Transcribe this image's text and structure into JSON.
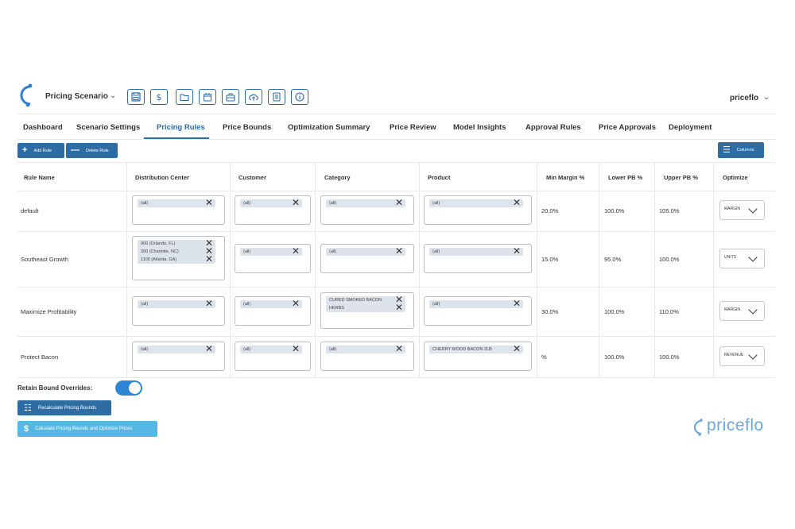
{
  "header": {
    "scenario_label": "Pricing Scenario",
    "user": "priceflo",
    "toolbar_icons": [
      "save-icon",
      "dollar-icon",
      "folder-icon",
      "calendar-icon",
      "briefcase-icon",
      "cloud-upload-icon",
      "document-icon",
      "info-icon"
    ]
  },
  "tabs": [
    "Dashboard",
    "Scenario Settings",
    "Pricing Rules",
    "Price Bounds",
    "Optimization Summary",
    "Price Review",
    "Model Insights",
    "Approval Rules",
    "Price Approvals",
    "Deployment"
  ],
  "active_tab": "Pricing Rules",
  "actions": {
    "add_rule": "Add Rule",
    "delete_rule": "Delete Rule",
    "columns": "Columns"
  },
  "table": {
    "headers": [
      "Rule Name",
      "Distribution Center",
      "Customer",
      "Category",
      "Product",
      "Min Margin %",
      "Lower PB %",
      "Upper PB %",
      "Optimize"
    ],
    "rows": [
      {
        "name": "default",
        "dc": [
          "(all)"
        ],
        "customer": [
          "(all)"
        ],
        "category": [
          "(all)"
        ],
        "product": [
          "(all)"
        ],
        "min_margin": "20.0%",
        "lower_pb": "100.0%",
        "upper_pb": "105.0%",
        "optimize": "MARGIN"
      },
      {
        "name": "Southeast Growth",
        "dc": [
          "900 (Orlando, FL)",
          "200 (Charlotte, NC)",
          "1100 (Atlanta, GA)"
        ],
        "customer": [
          "(all)"
        ],
        "category": [
          "(all)"
        ],
        "product": [
          "(all)"
        ],
        "min_margin": "15.0%",
        "lower_pb": "95.0%",
        "upper_pb": "100.0%",
        "optimize": "UNITS"
      },
      {
        "name": "Maximize Profitability",
        "dc": [
          "(all)"
        ],
        "customer": [
          "(all)"
        ],
        "category": [
          "CURED SMOKED BACON",
          "HERBS"
        ],
        "product": [
          "(all)"
        ],
        "min_margin": "30.0%",
        "lower_pb": "100.0%",
        "upper_pb": "110.0%",
        "optimize": "MARGIN"
      },
      {
        "name": "Protect Bacon",
        "dc": [
          "(all)"
        ],
        "customer": [
          "(all)"
        ],
        "category": [
          "(all)"
        ],
        "product": [
          "CHERRY WOOD BACON 2LB"
        ],
        "min_margin": "%",
        "lower_pb": "100.0%",
        "upper_pb": "100.0%",
        "optimize": "REVENUE"
      }
    ]
  },
  "footer": {
    "retain_label": "Retain Bound Overrides:",
    "retain_on": true,
    "recalc_label": "Recalculate Pricing Bounds",
    "calc_opt_label": "Calculate Pricing Bounds and Optimize Prices",
    "brand": "priceflo"
  },
  "colors": {
    "primary": "#2e6ca4",
    "toggle": "#2e86d6",
    "calc_button": "#56b6e4",
    "brand": "#6fa7d9",
    "chip": "#dde3ea"
  }
}
